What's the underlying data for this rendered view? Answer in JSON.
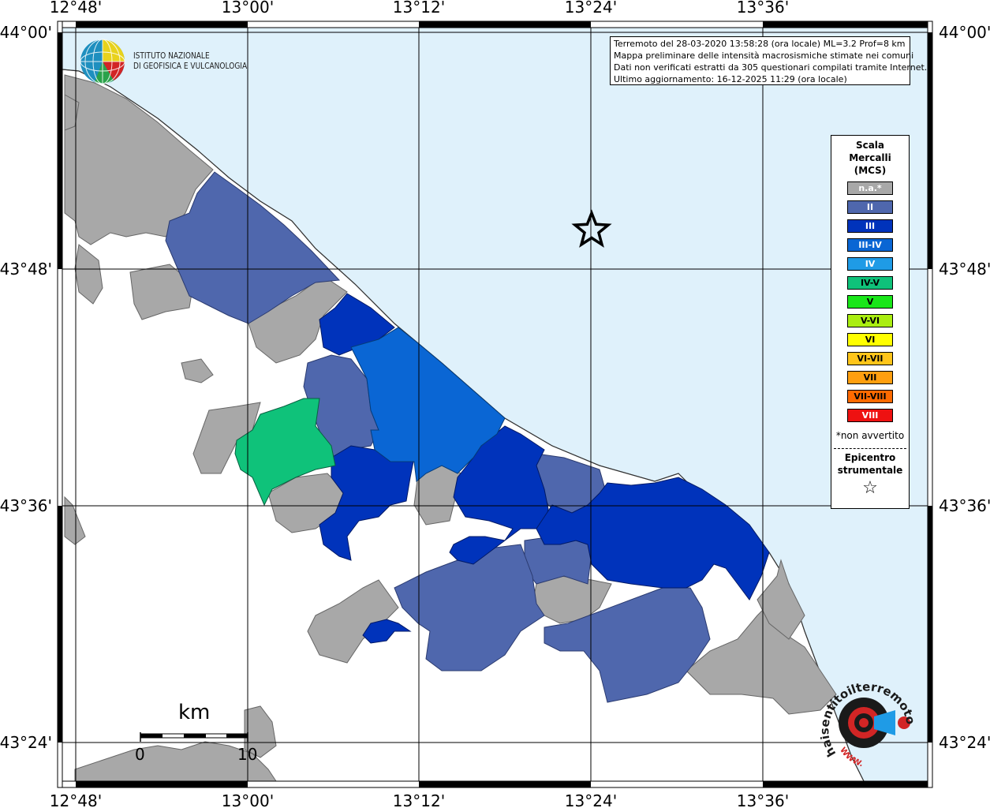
{
  "map": {
    "lon_labels": [
      "12°48'",
      "13°00'",
      "13°12'",
      "13°24'",
      "13°36'"
    ],
    "lat_labels": [
      "44°00'",
      "43°48'",
      "43°36'",
      "43°24'"
    ],
    "colors": {
      "sea": "#dff1fb",
      "land_gray": "#a8a8a8",
      "land_white": "#ffffff"
    }
  },
  "info_box": {
    "line1": "Terremoto del 28-03-2020 13:58:28 (ora locale) ML=3.2 Prof=8 km",
    "line2": "Mappa preliminare delle intensità macrosismiche stimate nei comuni",
    "line3": "Dati non verificati estratti da 305 questionari compilati tramite Internet.",
    "line4": "Ultimo aggiornamento: 16-12-2025 11:29 (ora locale)"
  },
  "institute": {
    "line1": "ISTITUTO NAZIONALE",
    "line2": "DI GEOFISICA E VULCANOLOGIA"
  },
  "legend": {
    "title1": "Scala",
    "title2": "Mercalli",
    "title3": "(MCS)",
    "items": [
      {
        "label": "n.a.*",
        "color": "#a8a8a8",
        "text_color": "#ffffff"
      },
      {
        "label": "II",
        "color": "#4f67ad",
        "text_color": "#ffffff"
      },
      {
        "label": "III",
        "color": "#0033bb",
        "text_color": "#ffffff"
      },
      {
        "label": "III-IV",
        "color": "#0a66d4",
        "text_color": "#ffffff"
      },
      {
        "label": "IV",
        "color": "#1f9be6",
        "text_color": "#ffffff"
      },
      {
        "label": "IV-V",
        "color": "#0fc27a",
        "text_color": "#000000"
      },
      {
        "label": "V",
        "color": "#19e619",
        "text_color": "#000000"
      },
      {
        "label": "V-VI",
        "color": "#aaee11",
        "text_color": "#000000"
      },
      {
        "label": "VI",
        "color": "#ffff00",
        "text_color": "#000000"
      },
      {
        "label": "VI-VII",
        "color": "#ffc51a",
        "text_color": "#000000"
      },
      {
        "label": "VII",
        "color": "#ff9f10",
        "text_color": "#000000"
      },
      {
        "label": "VII-VIII",
        "color": "#ff6a00",
        "text_color": "#000000"
      },
      {
        "label": "VIII",
        "color": "#ee1111",
        "text_color": "#ffffff"
      }
    ],
    "not_felt_note": "*non avvertito",
    "epicenter_line1": "Epicentro",
    "epicenter_line2": "strumentale",
    "epicenter_symbol": "☆"
  },
  "scale_bar": {
    "unit": "km",
    "min_label": "0",
    "max_label": "10"
  },
  "haisentito": {
    "brand": "haisentitoilterremoto.it",
    "url": "WWW."
  },
  "epicenter": {
    "lon": "13°24'",
    "lat": "43°51'"
  }
}
